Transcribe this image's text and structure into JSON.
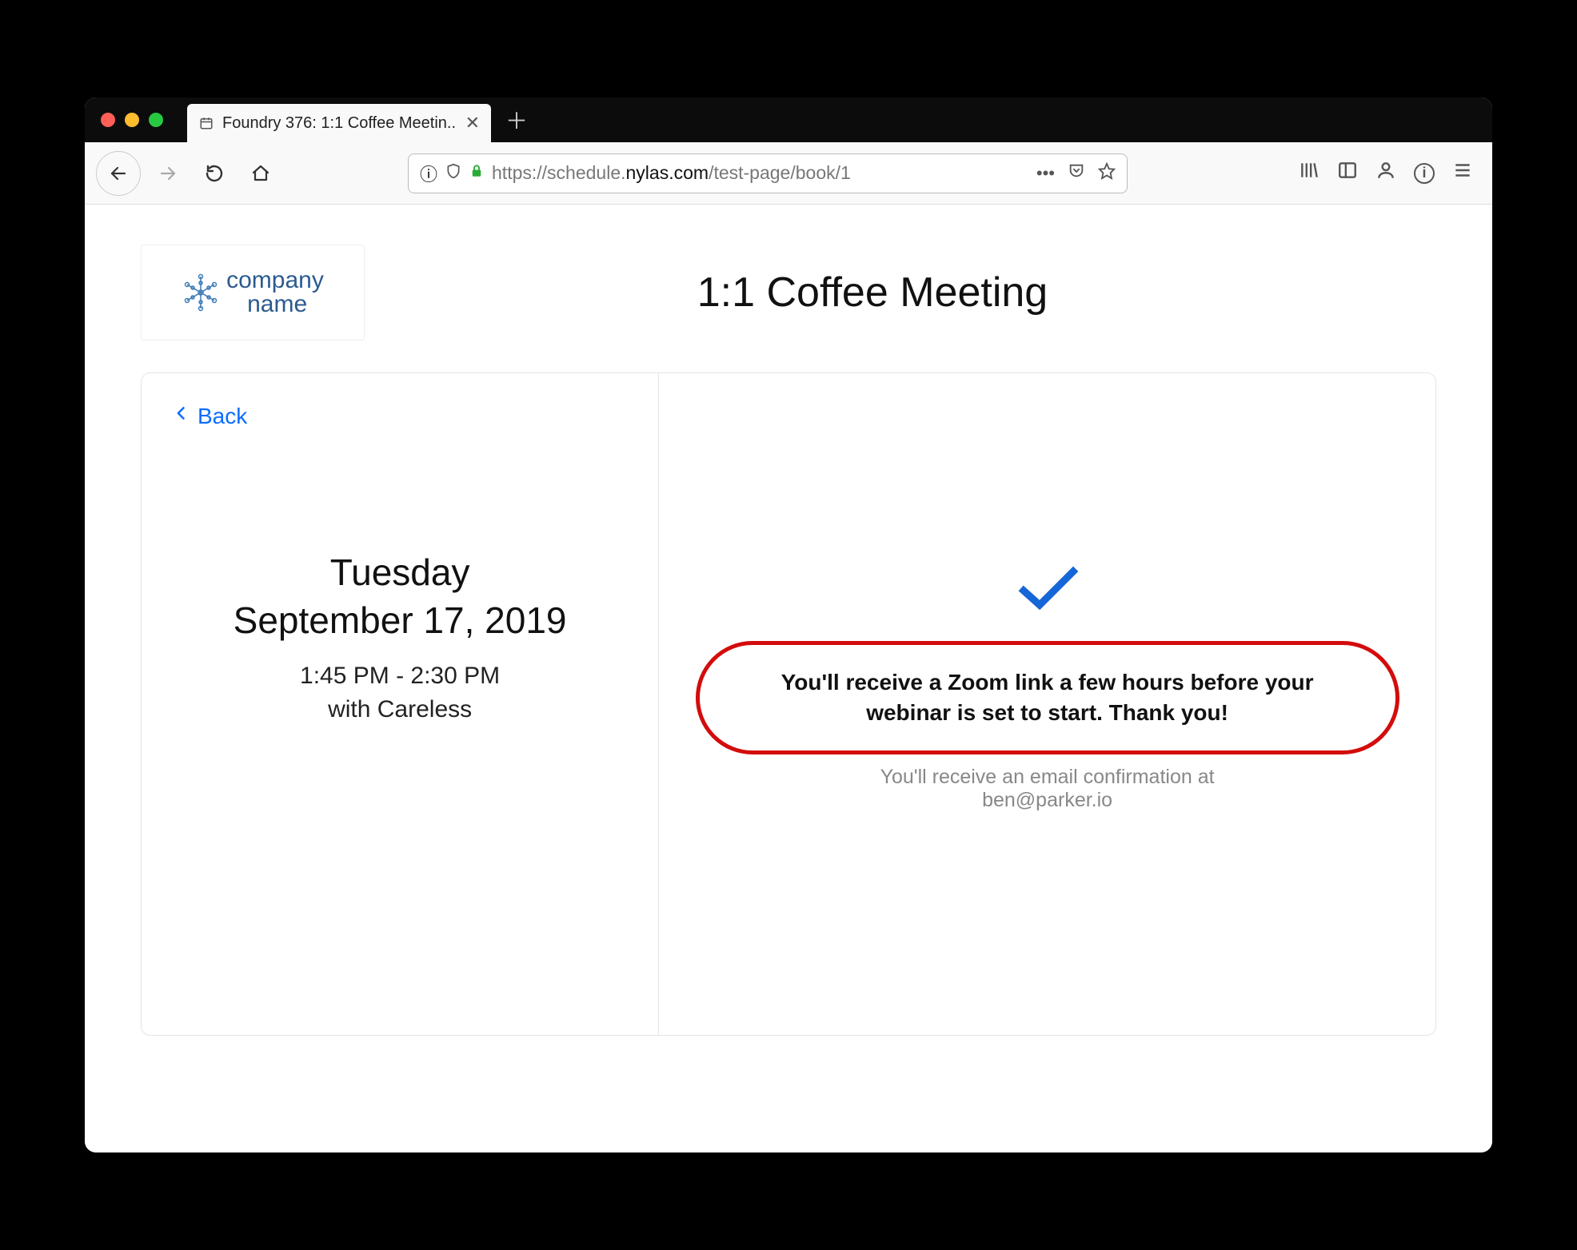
{
  "browser": {
    "tab": {
      "title": "Foundry 376: 1:1 Coffee Meetin.."
    },
    "url": {
      "prefix": "https://schedule.",
      "domain": "nylas.com",
      "path": "/test-page/book/1"
    }
  },
  "page": {
    "logo": {
      "line1": "company",
      "line2": "name"
    },
    "title": "1:1 Coffee Meeting",
    "back_label": "Back",
    "event": {
      "weekday": "Tuesday",
      "date": "September 17, 2019",
      "time_range": "1:45 PM - 2:30 PM",
      "host_prefix": "with ",
      "host": "Careless"
    },
    "confirmation": {
      "message": "You'll receive a Zoom link a few hours before your webinar is set to start. Thank you!",
      "email_line": "You'll receive an email confirmation at",
      "email": "ben@parker.io"
    }
  }
}
